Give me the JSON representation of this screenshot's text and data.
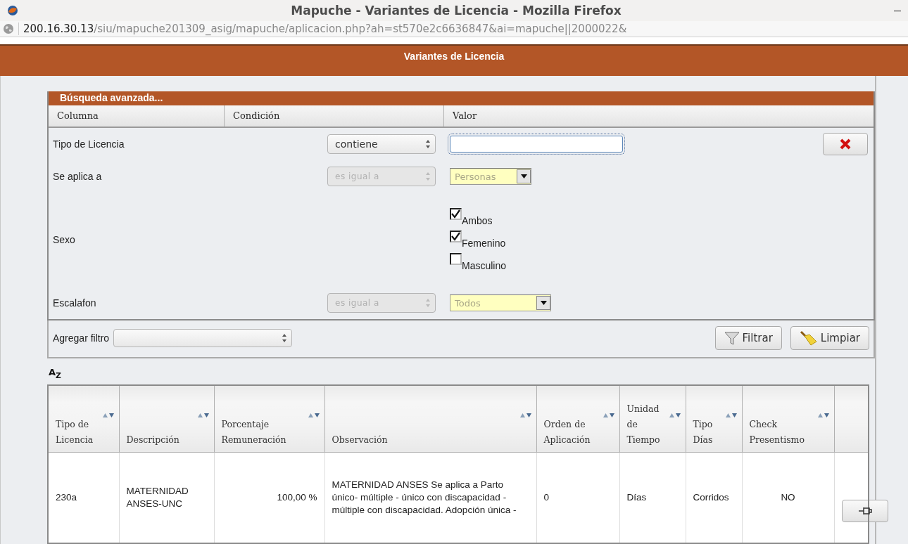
{
  "window": {
    "title": "Mapuche - Variantes de Licencia - Mozilla Firefox",
    "minimize": "–"
  },
  "address_bar": {
    "host": "200.16.30.13",
    "path": "/siu/mapuche201309_asig/mapuche/aplicacion.php?ah=st570e2c6636847&ai=mapuche||2000022&"
  },
  "page_title": "Variantes de Licencia",
  "search_panel": {
    "title": "Búsqueda avanzada...",
    "columns": [
      "Columna",
      "Condición",
      "Valor"
    ],
    "filters": [
      {
        "kind": "text",
        "label": "Tipo de Licencia",
        "condition": "contiene",
        "disabled": false,
        "removable": true
      },
      {
        "kind": "select",
        "label": "Se aplica a",
        "condition": "es igual a",
        "disabled": true,
        "removable": false,
        "value": "Personas"
      },
      {
        "kind": "checks",
        "label": "Sexo",
        "removable": false,
        "options": [
          {
            "label": "Ambos",
            "checked": true
          },
          {
            "label": "Femenino",
            "checked": true
          },
          {
            "label": "Masculino",
            "checked": false
          }
        ]
      },
      {
        "kind": "select",
        "label": "Escalafon",
        "condition": "es igual a",
        "disabled": true,
        "removable": false,
        "value": "Todos"
      }
    ],
    "add_filter": {
      "label": "Agregar filtro"
    },
    "buttons": [
      {
        "kind": "filter",
        "label": "Filtrar"
      },
      {
        "kind": "clear",
        "label": "Limpiar"
      }
    ]
  },
  "sort_icon": "A$_{Z}$",
  "table": {
    "columns": [
      {
        "label": "Tipo de Licencia",
        "sortable": true
      },
      {
        "label": "Descripción",
        "sortable": true
      },
      {
        "label": "Porcentaje Remuneración",
        "sortable": true
      },
      {
        "label": "Observación",
        "sortable": true
      },
      {
        "label": "Orden de Aplicación",
        "sortable": true
      },
      {
        "label": "Unidad de Tiempo",
        "sortable": true
      },
      {
        "label": "Tipo Días",
        "sortable": true
      },
      {
        "label": "Check Presentismo",
        "sortable": true
      },
      {
        "sortable": false
      }
    ],
    "rows": [
      {
        "cells": [
          "230a",
          "MATERNIDAD ANSES-UNC",
          "100,00 %",
          "MATERNIDAD ANSES Se aplica a Parto único- múltiple - único con discapacidad - múltiple con discapacidad. Adopción única -",
          "0",
          "Días",
          "Corridos",
          "NO"
        ]
      }
    ]
  }
}
